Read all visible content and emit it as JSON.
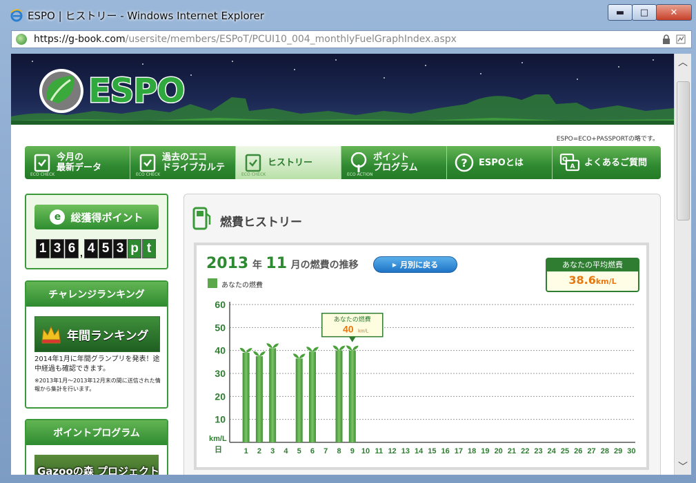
{
  "window": {
    "title": "ESPO | ヒストリー - Windows Internet Explorer",
    "minimize": "▬",
    "maximize": "□",
    "close": "✕"
  },
  "address": {
    "host": "https://g-book.com",
    "path": "/usersite/members/ESPoT/PCUI10_004_monthlyFuelGraphIndex.aspx"
  },
  "site": {
    "logo": "ESPO",
    "tagline": "ESPO=ECO+PASSPORTの略です。"
  },
  "nav": [
    {
      "label1": "今月の",
      "label2": "最新データ",
      "sub": "ECO CHECK"
    },
    {
      "label1": "過去のエコ",
      "label2": "ドライブカルテ",
      "sub": "ECO CHECK"
    },
    {
      "label1": "ヒストリー",
      "label2": "",
      "sub": "ECO CHECK"
    },
    {
      "label1": "ポイント",
      "label2": "プログラム",
      "sub": "ECO ACTION"
    },
    {
      "label1": "ESPOとは",
      "label2": "",
      "sub": ""
    },
    {
      "label1": "よくあるご質問",
      "label2": "",
      "sub": ""
    }
  ],
  "points": {
    "title": "総獲得ポイント",
    "badge": "e",
    "digits": [
      "1",
      "3",
      "6",
      ",",
      "4",
      "5",
      "3"
    ],
    "unit": [
      "p",
      "t"
    ]
  },
  "ranking": {
    "header": "チャレンジランキング",
    "banner": "年間ランキング",
    "text": "2014年1月に年間グランプリを発表！途中経過も確認できます。",
    "note": "※2013年1月～2013年12月末の間に送信された情報から集計を行います。"
  },
  "program": {
    "header": "ポイントプログラム",
    "banner": "Gazooの森 プロジェクト"
  },
  "panel": {
    "title": "燃費ヒストリー",
    "year": "2013",
    "year_suffix": "年",
    "month": "11",
    "month_suffix": "月の燃費の推移",
    "back_button": "月別に戻る",
    "legend": "あなたの燃費",
    "avg_label": "あなたの平均燃費",
    "avg_value": "38.6",
    "avg_unit": "km/L",
    "tooltip_label": "あなたの燃費",
    "tooltip_value": "40",
    "tooltip_unit": "km/L"
  },
  "colors": {
    "brand_green": "#2e8a30",
    "bar_green": "#4f9e3f",
    "accent_orange": "#e57811",
    "button_blue": "#1e74c6"
  },
  "chart_data": {
    "type": "bar",
    "ylabel": "km/L",
    "xlabel": "日",
    "ylim": [
      0,
      60
    ],
    "yticks": [
      10,
      20,
      30,
      40,
      50,
      60
    ],
    "categories": [
      "1",
      "2",
      "3",
      "4",
      "5",
      "6",
      "7",
      "8",
      "9",
      "10",
      "11",
      "12",
      "13",
      "14",
      "15",
      "16",
      "17",
      "18",
      "19",
      "20",
      "21",
      "22",
      "23",
      "24",
      "25",
      "26",
      "27",
      "28",
      "29",
      "30"
    ],
    "values": [
      39,
      37.5,
      41,
      null,
      36.5,
      39.5,
      null,
      40,
      40,
      null,
      null,
      null,
      null,
      null,
      null,
      null,
      null,
      null,
      null,
      null,
      null,
      null,
      null,
      null,
      null,
      null,
      null,
      null,
      null,
      null
    ],
    "highlight_index": 8,
    "grid": true
  }
}
